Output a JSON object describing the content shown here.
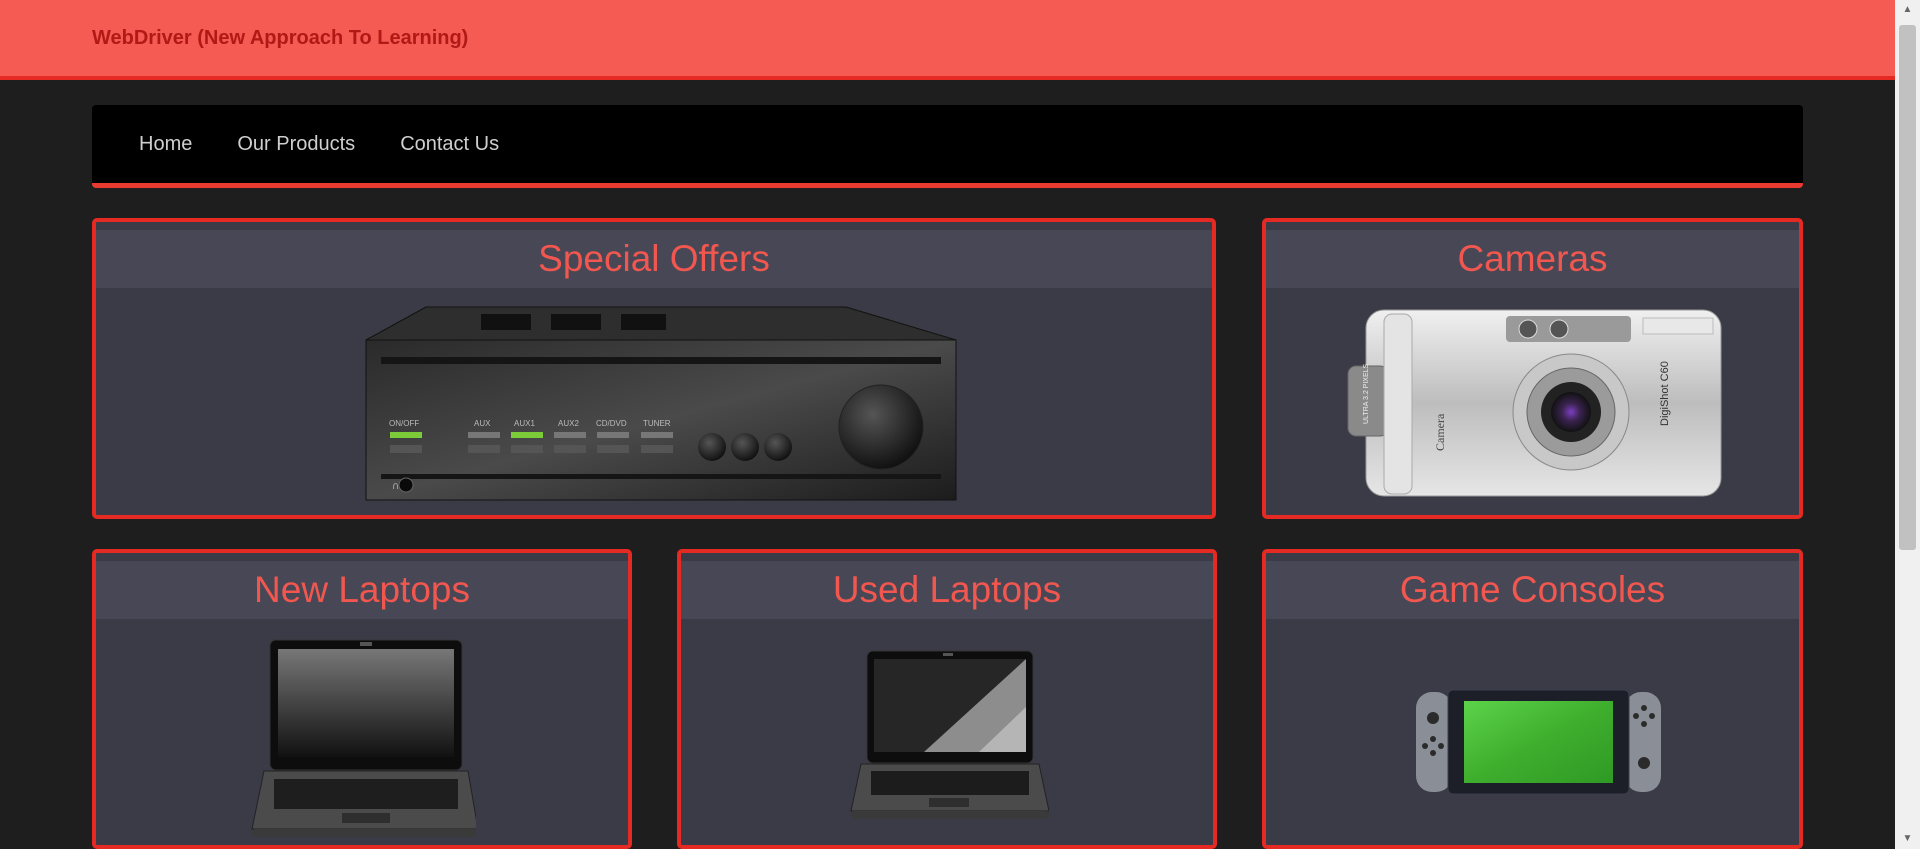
{
  "header": {
    "title": "WebDriver (New Approach To Learning)"
  },
  "nav": {
    "items": [
      "Home",
      "Our Products",
      "Contact Us"
    ]
  },
  "panels": {
    "special_offers": {
      "title": "Special Offers",
      "labels": [
        "ON/OFF",
        "AUX",
        "AUX1",
        "AUX2",
        "CD/DVD",
        "TUNER"
      ]
    },
    "cameras": {
      "title": "Cameras",
      "brand": "Camera",
      "model": "DigiShot C60",
      "feature": "ULTRA 3.2 PIXELS"
    },
    "new_laptops": {
      "title": "New Laptops"
    },
    "used_laptops": {
      "title": "Used Laptops"
    },
    "game_consoles": {
      "title": "Game Consoles"
    }
  },
  "colors": {
    "accent": "#e42a22",
    "header_bg": "#f55b53",
    "panel_bg": "#3b3b47",
    "panel_title": "#f2574f",
    "page_bg": "#1e1e1f"
  },
  "icons": {
    "scroll_up": "scroll-up-arrow-icon",
    "scroll_down": "scroll-down-arrow-icon"
  }
}
